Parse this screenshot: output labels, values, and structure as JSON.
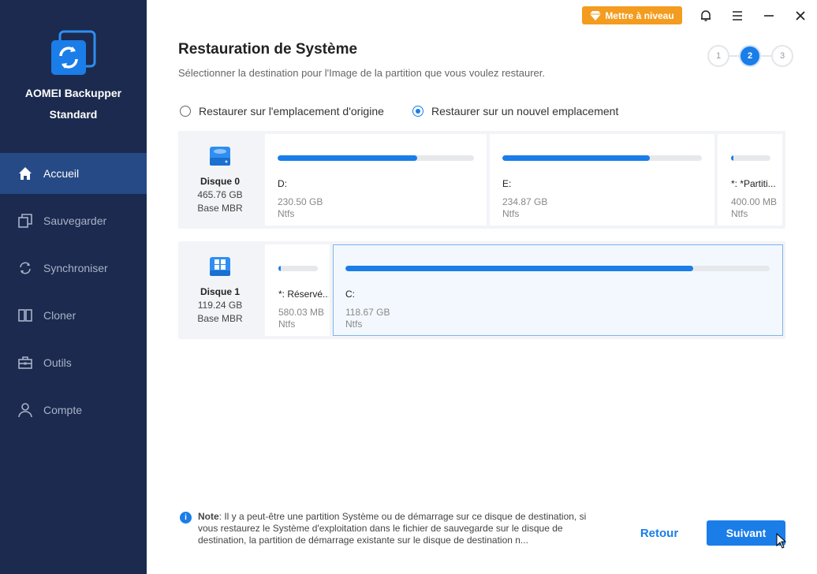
{
  "app": {
    "name": "AOMEI Backupper",
    "edition": "Standard"
  },
  "titlebar": {
    "upgrade_label": "Mettre à niveau"
  },
  "sidebar": {
    "items": [
      {
        "label": "Accueil",
        "icon": "home-icon",
        "active": true
      },
      {
        "label": "Sauvegarder",
        "icon": "backup-icon",
        "active": false
      },
      {
        "label": "Synchroniser",
        "icon": "sync-icon",
        "active": false
      },
      {
        "label": "Cloner",
        "icon": "clone-icon",
        "active": false
      },
      {
        "label": "Outils",
        "icon": "tools-icon",
        "active": false
      },
      {
        "label": "Compte",
        "icon": "user-icon",
        "active": false
      }
    ]
  },
  "page": {
    "title": "Restauration de Système",
    "subtitle": "Sélectionner la destination pour l'Image de la partition que vous voulez restaurer."
  },
  "steps": {
    "labels": [
      "1",
      "2",
      "3"
    ],
    "current": 2
  },
  "options": {
    "original": "Restaurer sur l'emplacement d'origine",
    "new_location": "Restaurer sur un nouvel emplacement",
    "selected": "new_location"
  },
  "disks": [
    {
      "name": "Disque 0",
      "size": "465.76 GB",
      "type": "Base MBR",
      "partitions": [
        {
          "name": "D:",
          "size": "230.50 GB",
          "fs": "Ntfs",
          "used_fraction": 0.71
        },
        {
          "name": "E:",
          "size": "234.87 GB",
          "fs": "Ntfs",
          "used_fraction": 0.74
        },
        {
          "name": "*: *Partiti...",
          "size": "400.00 MB",
          "fs": "Ntfs",
          "used_fraction": 0.06
        }
      ]
    },
    {
      "name": "Disque 1",
      "size": "119.24 GB",
      "type": "Base MBR",
      "partitions": [
        {
          "name": "*: Réservé...",
          "size": "580.03 MB",
          "fs": "Ntfs",
          "used_fraction": 0.06
        },
        {
          "name": "C:",
          "size": "118.67 GB",
          "fs": "Ntfs",
          "used_fraction": 0.82,
          "selected": true
        }
      ]
    }
  ],
  "note": {
    "label": "Note",
    "text": ": Il y a peut-être une partition Système ou de démarrage sur ce disque de destination, si vous restaurez le Système d'exploitation dans le fichier de sauvegarde sur le disque de destination, la partition de démarrage existante sur le disque de destination n..."
  },
  "footer": {
    "back_label": "Retour",
    "next_label": "Suivant"
  },
  "colors": {
    "sidebar_bg": "#1b2a4e",
    "active_nav": "#264a86",
    "accent": "#1a7de8",
    "upgrade": "#f39c1f"
  }
}
